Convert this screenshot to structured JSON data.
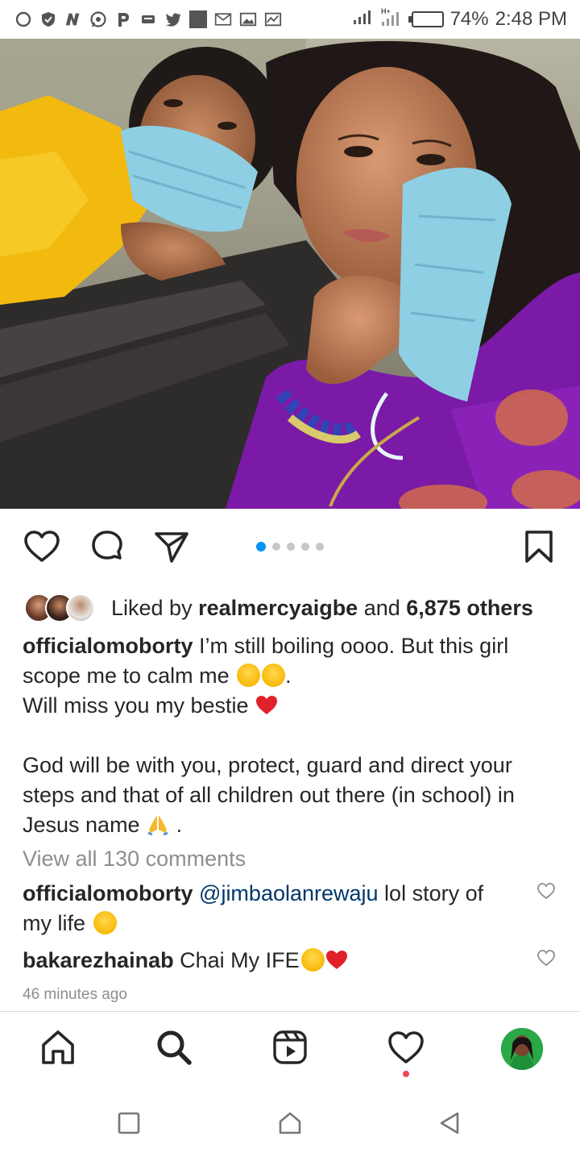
{
  "status_bar": {
    "left_icons": [
      "chat-bubble-icon",
      "shield-icon",
      "n-app-icon",
      "whatsapp-icon",
      "p-app-icon",
      "message-icon",
      "twitter-icon",
      "square-icon",
      "gmail-icon",
      "image-icon",
      "chart-icon"
    ],
    "battery_percent": 74,
    "battery_label": "74%",
    "time": "2:48 PM",
    "network": "H+"
  },
  "post": {
    "carousel": {
      "count": 5,
      "active_index": 0
    },
    "liked_by_prefix": "Liked by ",
    "liked_by_user": "realmercyaigbe",
    "liked_by_mid": " and ",
    "liked_by_count": "6,875 others",
    "caption": {
      "username": "officialomoborty",
      "line1": " I’m still boiling oooo. But this girl",
      "line2": "scope me to calm me ",
      "line2_end": ".",
      "line3": "Will miss you my bestie ",
      "line5": "God will be with you, protect, guard and direct your",
      "line6": "steps and that of all children out there (in school) in",
      "line7": "Jesus name ",
      "line7_end": " ."
    },
    "view_all_comments": "View all 130 comments",
    "comments": [
      {
        "username": "officialomoborty",
        "mention": "@jimbaolanrewaju",
        "text": " lol story of",
        "text2": "my life "
      },
      {
        "username": "bakarezhainab",
        "text": " Chai My IFE"
      }
    ],
    "timestamp": "46 minutes ago"
  },
  "tabbar": {
    "items": [
      "home-icon",
      "search-icon",
      "reels-icon",
      "activity-heart-icon",
      "profile-avatar"
    ]
  },
  "system_nav": [
    "recents-square-icon",
    "home-house-icon",
    "back-triangle-icon"
  ],
  "colors": {
    "accent_blue": "#0095f6",
    "link_blue": "#00376b",
    "heart_red": "#e0212a",
    "muted_gray": "#8e8e8e"
  }
}
